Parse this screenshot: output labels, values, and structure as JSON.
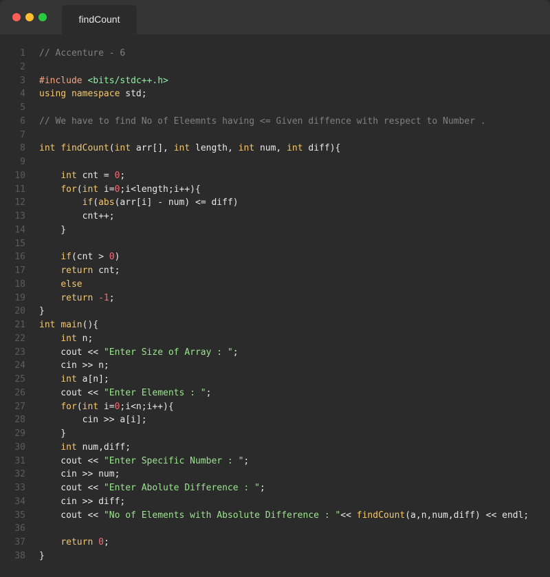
{
  "window": {
    "tab_title": "findCount",
    "colors": {
      "close": "#ff5f57",
      "minimize": "#febc2e",
      "maximize": "#28c840",
      "background": "#2b2b2b",
      "titlebar": "#353535"
    }
  },
  "code": {
    "lines": [
      [
        [
          "c",
          "// Accenture - 6"
        ]
      ],
      [],
      [
        [
          "p",
          "#include "
        ],
        [
          "i",
          "<bits/stdc++.h>"
        ]
      ],
      [
        [
          "k",
          "using"
        ],
        [
          "t",
          " "
        ],
        [
          "k",
          "namespace"
        ],
        [
          "t",
          " std;"
        ]
      ],
      [],
      [
        [
          "c",
          "// We have to find No of Eleemnts having <= Given diffence with respect to Number ."
        ]
      ],
      [],
      [
        [
          "k",
          "int"
        ],
        [
          "t",
          " "
        ],
        [
          "f",
          "findCount"
        ],
        [
          "t",
          "("
        ],
        [
          "k",
          "int"
        ],
        [
          "t",
          " arr[], "
        ],
        [
          "k",
          "int"
        ],
        [
          "t",
          " length, "
        ],
        [
          "k",
          "int"
        ],
        [
          "t",
          " num, "
        ],
        [
          "k",
          "int"
        ],
        [
          "t",
          " diff){"
        ]
      ],
      [],
      [
        [
          "t",
          "    "
        ],
        [
          "k",
          "int"
        ],
        [
          "t",
          " cnt = "
        ],
        [
          "n",
          "0"
        ],
        [
          "t",
          ";"
        ]
      ],
      [
        [
          "t",
          "    "
        ],
        [
          "k",
          "for"
        ],
        [
          "t",
          "("
        ],
        [
          "k",
          "int"
        ],
        [
          "t",
          " i="
        ],
        [
          "n",
          "0"
        ],
        [
          "t",
          ";i<length;i++){"
        ]
      ],
      [
        [
          "t",
          "        "
        ],
        [
          "k",
          "if"
        ],
        [
          "t",
          "("
        ],
        [
          "f",
          "abs"
        ],
        [
          "t",
          "(arr[i] - num) <= diff)"
        ]
      ],
      [
        [
          "t",
          "        cnt++;"
        ]
      ],
      [
        [
          "t",
          "    }"
        ]
      ],
      [],
      [
        [
          "t",
          "    "
        ],
        [
          "k",
          "if"
        ],
        [
          "t",
          "(cnt > "
        ],
        [
          "n",
          "0"
        ],
        [
          "t",
          ")"
        ]
      ],
      [
        [
          "t",
          "    "
        ],
        [
          "k",
          "return"
        ],
        [
          "t",
          " cnt;"
        ]
      ],
      [
        [
          "t",
          "    "
        ],
        [
          "k",
          "else"
        ]
      ],
      [
        [
          "t",
          "    "
        ],
        [
          "k",
          "return"
        ],
        [
          "t",
          " "
        ],
        [
          "n",
          "-1"
        ],
        [
          "t",
          ";"
        ]
      ],
      [
        [
          "t",
          "}"
        ]
      ],
      [
        [
          "k",
          "int"
        ],
        [
          "t",
          " "
        ],
        [
          "f",
          "main"
        ],
        [
          "t",
          "(){"
        ]
      ],
      [
        [
          "t",
          "    "
        ],
        [
          "k",
          "int"
        ],
        [
          "t",
          " n;"
        ]
      ],
      [
        [
          "t",
          "    cout << "
        ],
        [
          "s",
          "\"Enter Size of Array : \""
        ],
        [
          "t",
          ";"
        ]
      ],
      [
        [
          "t",
          "    cin >> n;"
        ]
      ],
      [
        [
          "t",
          "    "
        ],
        [
          "k",
          "int"
        ],
        [
          "t",
          " a[n];"
        ]
      ],
      [
        [
          "t",
          "    cout << "
        ],
        [
          "s",
          "\"Enter Elements : \""
        ],
        [
          "t",
          ";"
        ]
      ],
      [
        [
          "t",
          "    "
        ],
        [
          "k",
          "for"
        ],
        [
          "t",
          "("
        ],
        [
          "k",
          "int"
        ],
        [
          "t",
          " i="
        ],
        [
          "n",
          "0"
        ],
        [
          "t",
          ";i<n;i++){"
        ]
      ],
      [
        [
          "t",
          "        cin >> a[i];"
        ]
      ],
      [
        [
          "t",
          "    }"
        ]
      ],
      [
        [
          "t",
          "    "
        ],
        [
          "k",
          "int"
        ],
        [
          "t",
          " num,diff;"
        ]
      ],
      [
        [
          "t",
          "    cout << "
        ],
        [
          "s",
          "\"Enter Specific Number : \""
        ],
        [
          "t",
          ";"
        ]
      ],
      [
        [
          "t",
          "    cin >> num;"
        ]
      ],
      [
        [
          "t",
          "    cout << "
        ],
        [
          "s",
          "\"Enter Abolute Difference : \""
        ],
        [
          "t",
          ";"
        ]
      ],
      [
        [
          "t",
          "    cin >> diff;"
        ]
      ],
      [
        [
          "t",
          "    cout << "
        ],
        [
          "s",
          "\"No of Elements with Absolute Difference : \""
        ],
        [
          "t",
          "<< "
        ],
        [
          "f",
          "findCount"
        ],
        [
          "t",
          "(a,n,num,diff) << endl;"
        ]
      ],
      [],
      [
        [
          "t",
          "    "
        ],
        [
          "k",
          "return"
        ],
        [
          "t",
          " "
        ],
        [
          "n",
          "0"
        ],
        [
          "t",
          ";"
        ]
      ],
      [
        [
          "t",
          "}"
        ]
      ]
    ]
  }
}
